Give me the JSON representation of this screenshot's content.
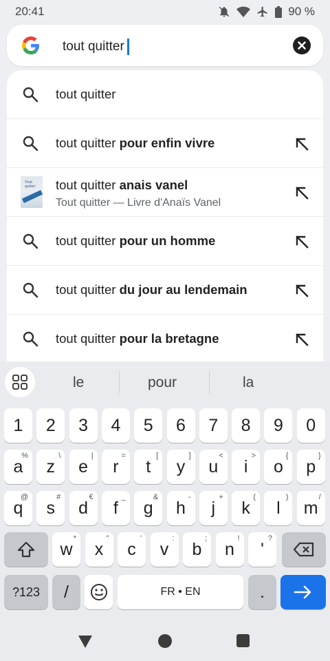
{
  "status": {
    "time": "20:41",
    "battery": "90 %"
  },
  "search": {
    "query": "tout quitter"
  },
  "suggestions": [
    {
      "type": "search",
      "prefix": "tout quitter",
      "bold": ""
    },
    {
      "type": "search",
      "prefix": "tout quitter ",
      "bold": "pour enfin vivre"
    },
    {
      "type": "entity",
      "prefix": "tout quitter ",
      "bold": "anais vanel",
      "sub": "Tout quitter — Livre d'Anaïs Vanel",
      "thumb_text": "Tout quitter"
    },
    {
      "type": "search",
      "prefix": "tout quitter ",
      "bold": "pour un homme"
    },
    {
      "type": "search",
      "prefix": "tout quitter ",
      "bold": "du jour au lendemain"
    },
    {
      "type": "search",
      "prefix": "tout quitter ",
      "bold": "pour la bretagne"
    }
  ],
  "keyboard": {
    "predictions": [
      "le",
      "pour",
      "la"
    ],
    "row_numbers": [
      "1",
      "2",
      "3",
      "4",
      "5",
      "6",
      "7",
      "8",
      "9",
      "0"
    ],
    "row1": [
      {
        "k": "a",
        "s": "%"
      },
      {
        "k": "z",
        "s": "\\"
      },
      {
        "k": "e",
        "s": "|"
      },
      {
        "k": "r",
        "s": "="
      },
      {
        "k": "t",
        "s": "["
      },
      {
        "k": "y",
        "s": "]"
      },
      {
        "k": "u",
        "s": "<"
      },
      {
        "k": "i",
        "s": ">"
      },
      {
        "k": "o",
        "s": "{"
      },
      {
        "k": "p",
        "s": "}"
      }
    ],
    "row2": [
      {
        "k": "q",
        "s": "@"
      },
      {
        "k": "s",
        "s": "#"
      },
      {
        "k": "d",
        "s": "€"
      },
      {
        "k": "f",
        "s": "_"
      },
      {
        "k": "g",
        "s": "&"
      },
      {
        "k": "h",
        "s": "-"
      },
      {
        "k": "j",
        "s": "+"
      },
      {
        "k": "k",
        "s": "("
      },
      {
        "k": "l",
        "s": ")"
      },
      {
        "k": "m",
        "s": "/"
      }
    ],
    "row3": [
      {
        "k": "w",
        "s": "*"
      },
      {
        "k": "x",
        "s": "\""
      },
      {
        "k": "c",
        "s": "'"
      },
      {
        "k": "v",
        "s": ":"
      },
      {
        "k": "b",
        "s": ";"
      },
      {
        "k": "n",
        "s": "!"
      },
      {
        "k": "'",
        "s": "?"
      }
    ],
    "sym_label": "?123",
    "slash": "/",
    "space_label": "FR • EN",
    "period": "."
  },
  "colors": {
    "accent": "#1a73e8"
  }
}
